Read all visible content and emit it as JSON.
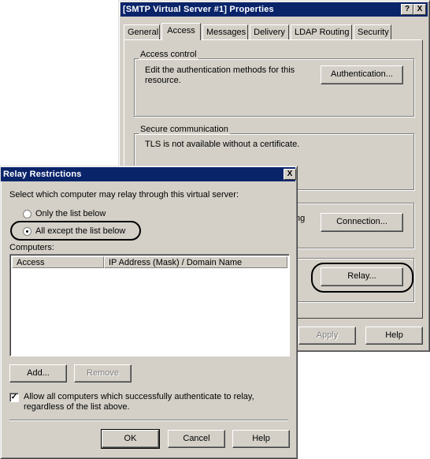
{
  "properties": {
    "title": "[SMTP Virtual Server #1] Properties",
    "help_glyph": "?",
    "close_glyph": "X",
    "tabs": [
      "General",
      "Access",
      "Messages",
      "Delivery",
      "LDAP Routing",
      "Security"
    ],
    "active_tab": "Access",
    "access_control": {
      "legend": "Access control",
      "text": "Edit the authentication methods for this resource.",
      "button": "Authentication..."
    },
    "secure_comm": {
      "legend": "Secure communication",
      "text": "TLS is not available without a certificate."
    },
    "connection_fragment": "ng",
    "connection_button": "Connection...",
    "relay_button": "Relay...",
    "apply_button": "Apply",
    "help_button": "Help"
  },
  "relay": {
    "title": "Relay Restrictions",
    "close_glyph": "X",
    "prompt": "Select which computer may relay through this virtual server:",
    "option_only": "Only the list below",
    "option_all_except": "All except the list below",
    "selected_option": "All except the list below",
    "computers_label": "Computers:",
    "columns": [
      "Access",
      "IP Address (Mask) / Domain Name"
    ],
    "rows": [],
    "add_button": "Add...",
    "remove_button": "Remove",
    "allow_auth_label": "Allow all computers which successfully authenticate to relay, regardless of the list above.",
    "allow_auth_checked": true,
    "ok_button": "OK",
    "cancel_button": "Cancel",
    "help_button": "Help"
  }
}
